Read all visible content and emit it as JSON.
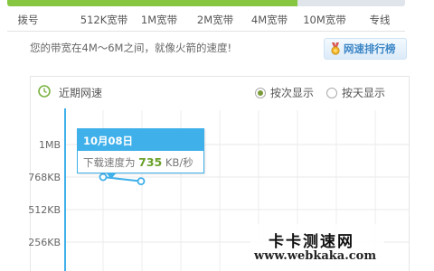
{
  "speed_scale": {
    "labels": [
      "拨号",
      "512K宽带",
      "1M宽带",
      "2M宽带",
      "4M宽带",
      "10M宽带",
      "专线"
    ],
    "fill_percent": 73,
    "fill_color": "#86c640",
    "track_color": "#dfe5ea"
  },
  "bandwidth_note": "您的带宽在4M～6M之间，就像火箭的速度!",
  "rank_button": {
    "label": "网速排行榜",
    "icon": "medal-icon"
  },
  "recent_panel": {
    "title": "近期网速",
    "icon": "clock-icon",
    "options": [
      {
        "label": "按次显示",
        "selected": true
      },
      {
        "label": "按天显示",
        "selected": false
      }
    ]
  },
  "chart_data": {
    "type": "line",
    "y_ticks": [
      "1MB",
      "768KB",
      "512KB",
      "256KB"
    ],
    "y_unit": "KB",
    "ylim": [
      0,
      1024
    ],
    "grid": true,
    "series": [
      {
        "values": [
          768,
          735
        ],
        "color": "#3fb0ea"
      }
    ]
  },
  "tooltip": {
    "date": "10月08日",
    "label": "下载速度为",
    "value": "735",
    "unit": "KB/秒"
  },
  "watermark": {
    "cn": "卡卡测速网",
    "url": "www.webkaka.com"
  },
  "accent_color": "#3fb0ea"
}
